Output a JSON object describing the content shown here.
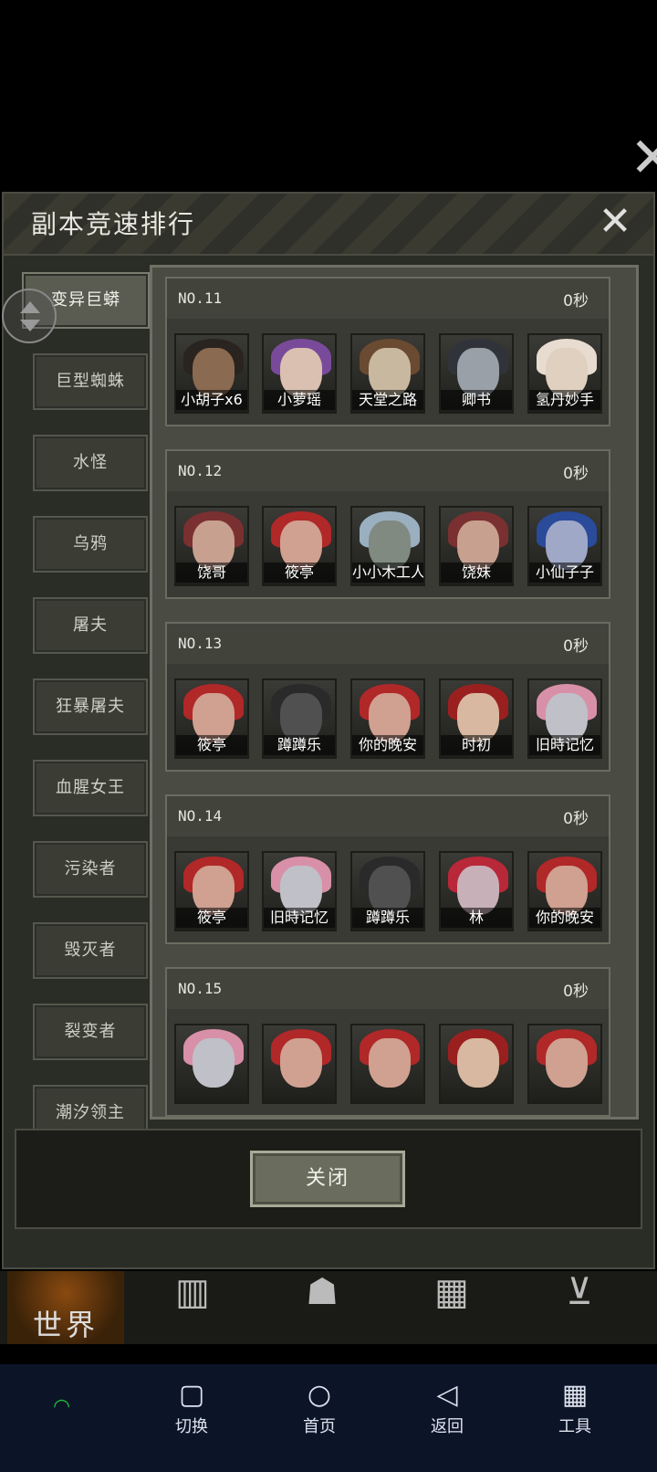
{
  "background": {
    "world_tab_label": "世界"
  },
  "modal": {
    "title": "副本竞速排行",
    "close_icon": "close-icon",
    "close_button_label": "关闭"
  },
  "tabs": [
    {
      "label": "变异巨蟒",
      "active": true
    },
    {
      "label": "巨型蜘蛛"
    },
    {
      "label": "水怪"
    },
    {
      "label": "乌鸦"
    },
    {
      "label": "屠夫"
    },
    {
      "label": "狂暴屠夫"
    },
    {
      "label": "血腥女王"
    },
    {
      "label": "污染者"
    },
    {
      "label": "毁灭者"
    },
    {
      "label": "裂变者"
    },
    {
      "label": "潮汐领主"
    }
  ],
  "rankings": [
    {
      "rank": "NO.11",
      "time": "0秒",
      "players": [
        "小胡子x6",
        "小萝瑶",
        "天堂之路",
        "卿书",
        "氢丹妙手"
      ]
    },
    {
      "rank": "NO.12",
      "time": "0秒",
      "players": [
        "饶哥",
        "筱亭",
        "小小木工人",
        "饶妹",
        "小仙子子"
      ]
    },
    {
      "rank": "NO.13",
      "time": "0秒",
      "players": [
        "筱亭",
        "蹲蹲乐",
        "你的晚安",
        "时初",
        "旧時记忆"
      ]
    },
    {
      "rank": "NO.14",
      "time": "0秒",
      "players": [
        "筱亭",
        "旧時记忆",
        "蹲蹲乐",
        "林",
        "你的晚安"
      ]
    },
    {
      "rank": "NO.15",
      "time": "0秒",
      "players": [
        "",
        "",
        "",
        "",
        ""
      ]
    }
  ],
  "navbar": {
    "items": [
      {
        "label": "切换",
        "icon": "square-icon"
      },
      {
        "label": "首页",
        "icon": "circle-icon"
      },
      {
        "label": "返回",
        "icon": "back-triangle-icon"
      },
      {
        "label": "工具",
        "icon": "grid-icon"
      }
    ]
  },
  "colors": {
    "modal_bg": "#2a2c26",
    "panel_bg": "#4a4c44",
    "navbar_bg": "#0c1528",
    "wifi": "#22b83a"
  }
}
